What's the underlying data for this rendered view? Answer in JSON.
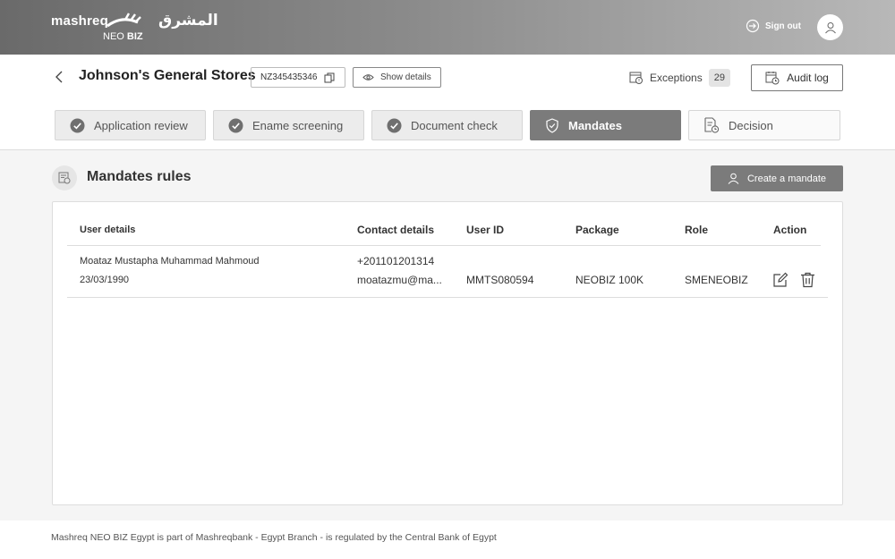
{
  "header": {
    "brand": "mashreq",
    "brand_arabic": "المشرق",
    "sub_prefix": "NEO",
    "sub_bold": "BIZ",
    "signout_label": "Sign out"
  },
  "title_bar": {
    "company": "Johnson's General Stores",
    "reference_id": "NZ345435346",
    "show_details_label": "Show details",
    "exceptions_label": "Exceptions",
    "exceptions_count": "29",
    "audit_log_label": "Audit log"
  },
  "steps": [
    {
      "label": "Application review",
      "state": "done"
    },
    {
      "label": "Ename screening",
      "state": "done"
    },
    {
      "label": "Document check",
      "state": "done"
    },
    {
      "label": "Mandates",
      "state": "active"
    },
    {
      "label": "Decision",
      "state": "pending"
    }
  ],
  "section": {
    "title": "Mandates rules",
    "create_button": "Create a mandate"
  },
  "table": {
    "columns": {
      "user_details": "User details",
      "contact_details": "Contact details",
      "user_id": "User ID",
      "package": "Package",
      "role": "Role",
      "action": "Action"
    },
    "rows": [
      {
        "name": "Moataz Mustapha Muhammad Mahmoud",
        "dob": "23/03/1990",
        "phone": "+201101201314",
        "email": "moatazmu@ma...",
        "user_id": "MMTS080594",
        "package": "NEOBIZ 100K",
        "role": "SMENEOBIZ"
      }
    ]
  },
  "footer": {
    "text": "Mashreq NEO BIZ Egypt is part of Mashreqbank - Egypt Branch - is regulated by the Central Bank of Egypt"
  },
  "colors": {
    "active_step": "#7b7b7b",
    "header_start": "#6a6a6a",
    "header_end": "#b8b8b8"
  }
}
